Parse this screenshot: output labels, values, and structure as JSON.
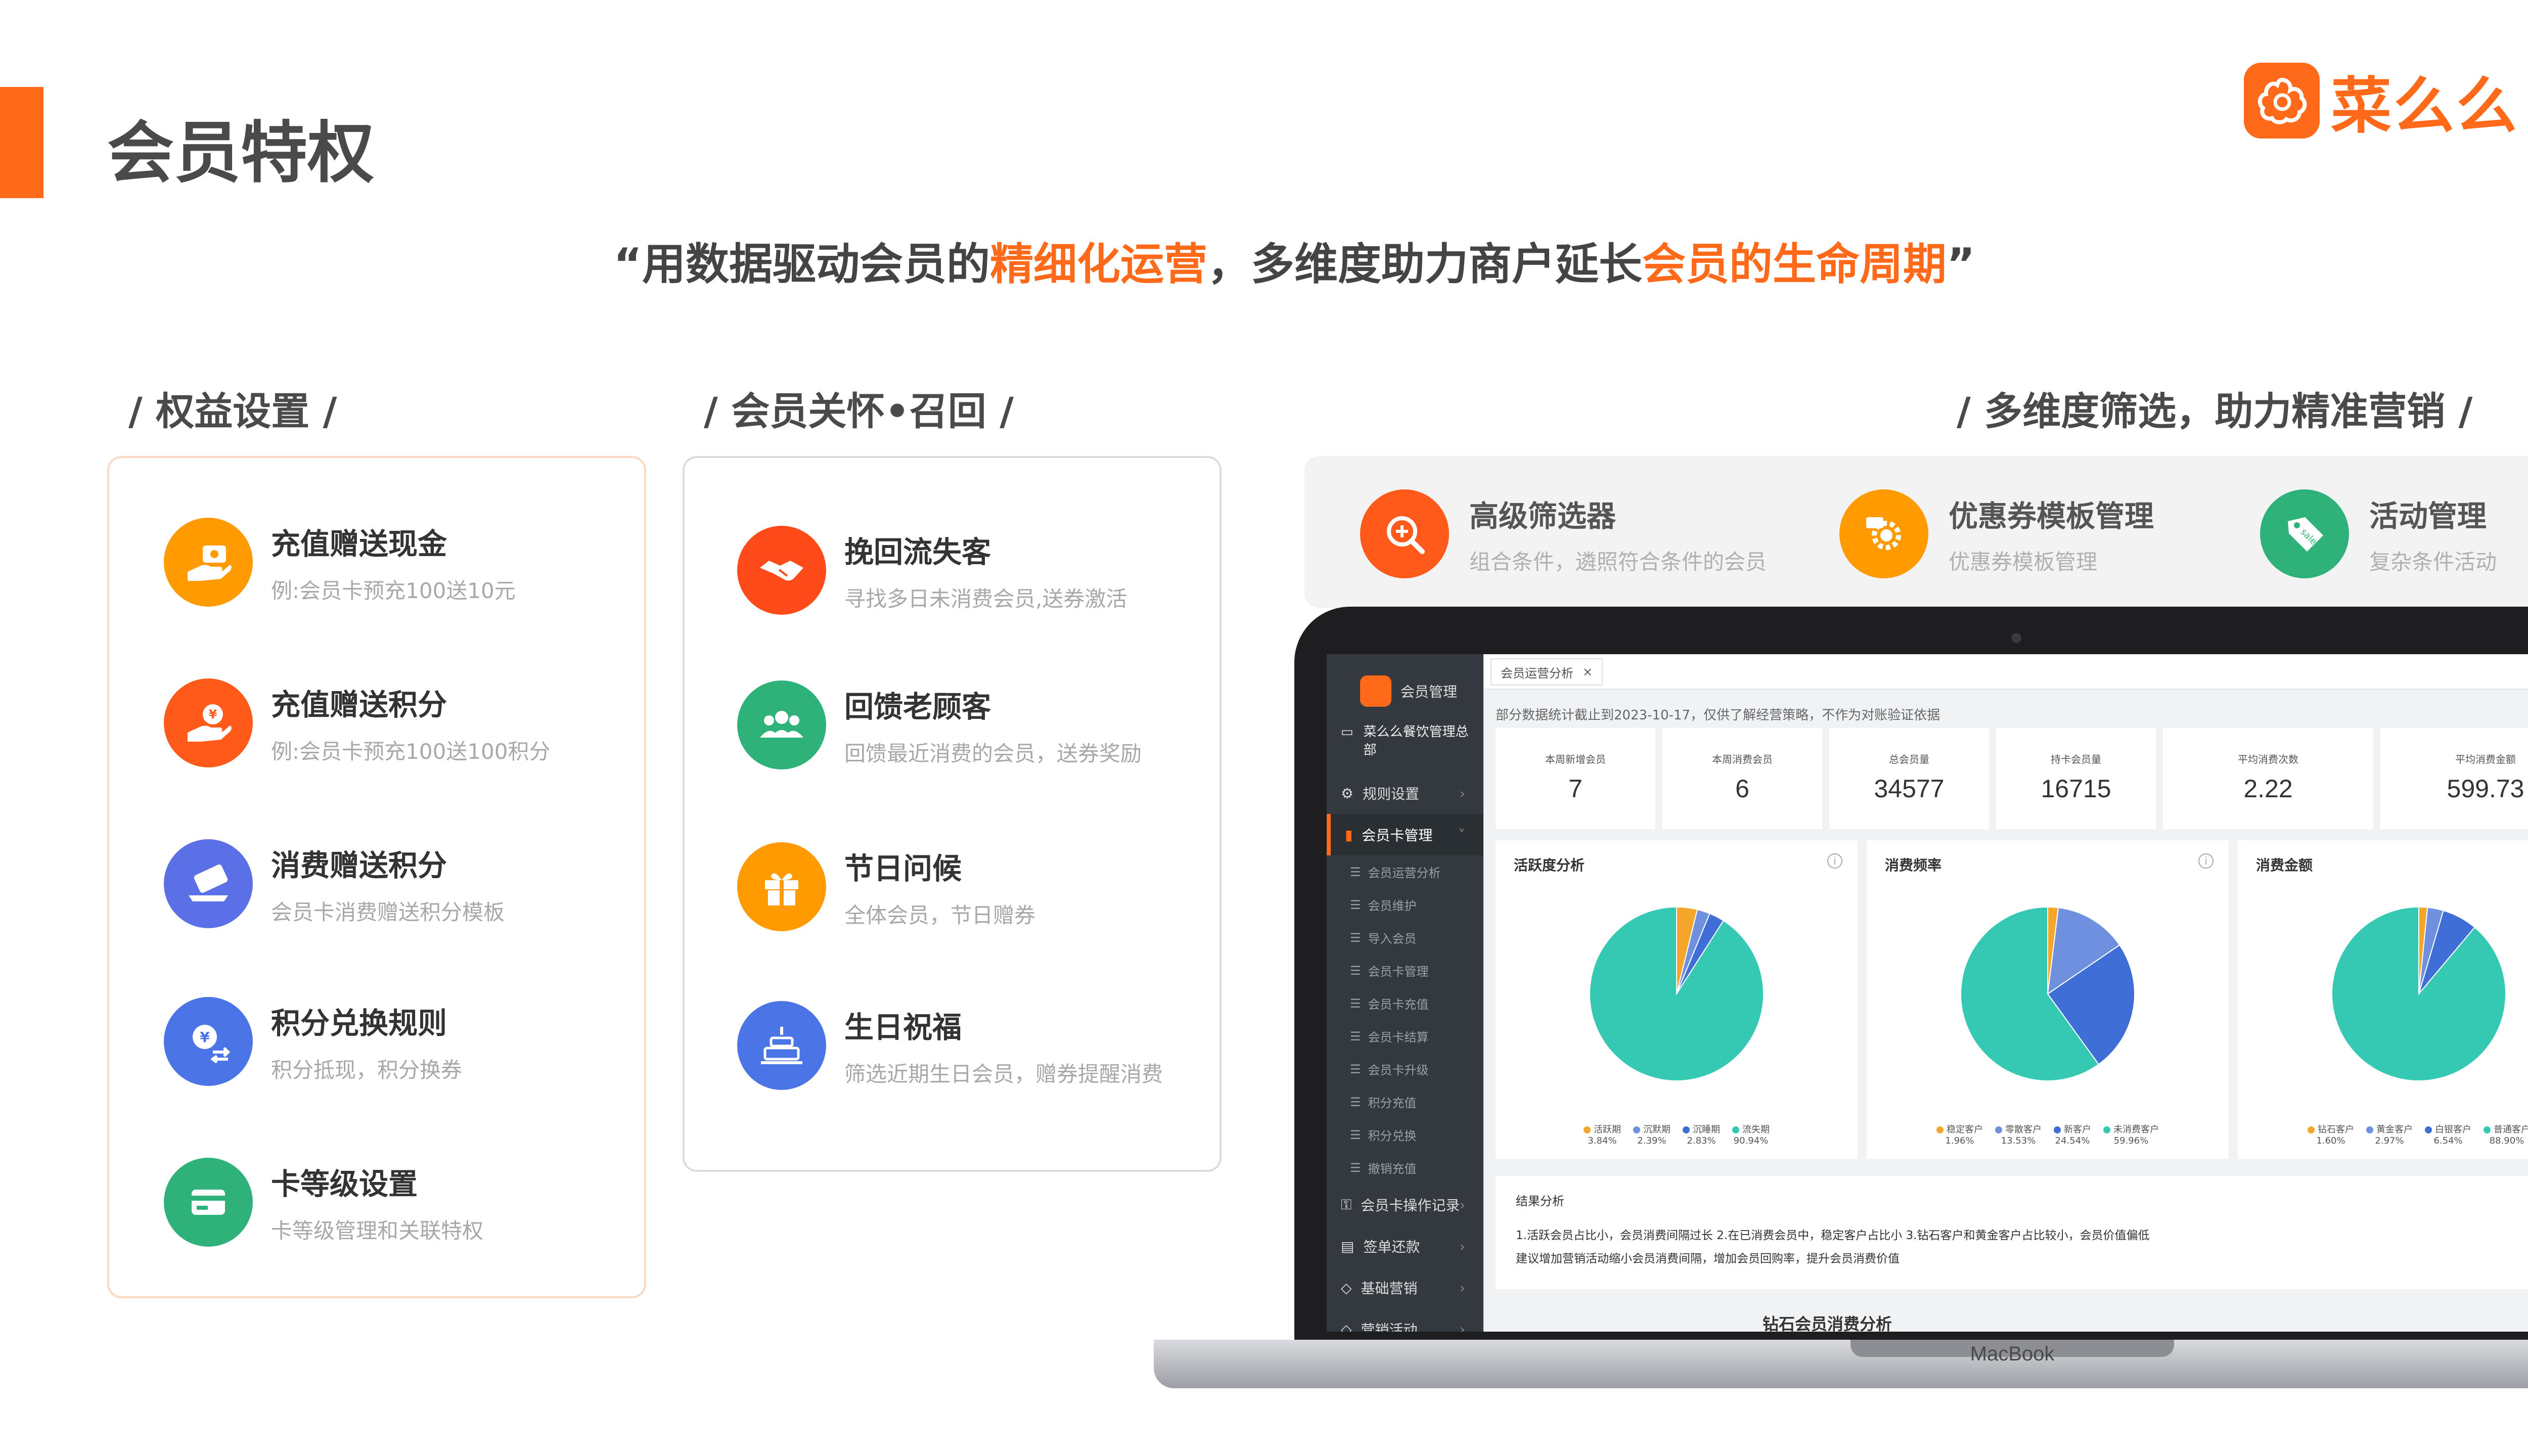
{
  "title": "会员特权",
  "brand": {
    "name": "菜么么",
    "color": "#ff6a1a"
  },
  "slogan": {
    "p1": "“用数据驱动会员的",
    "h1": "精细化运营",
    "p2": "，多维度助力商户延长",
    "h2": "会员的生命周期",
    "p3": "”"
  },
  "sections": {
    "benefits": "/ 权益设置 /",
    "care": "/ 会员关怀•召回 /",
    "filter": "/ 多维度筛选，助力精准营销 /"
  },
  "benefits": [
    {
      "title": "充值赠送现金",
      "desc": "例:会员卡预充100送10元",
      "icon": "cash-hand-icon",
      "color": "#ff9a00"
    },
    {
      "title": "充值赠送积分",
      "desc": "例:会员卡预充100送100积分",
      "icon": "points-hand-icon",
      "color": "#ff5a1a"
    },
    {
      "title": "消费赠送积分",
      "desc": "会员卡消费赠送积分模板",
      "icon": "card-swipe-icon",
      "color": "#5b6fe6"
    },
    {
      "title": "积分兑换规则",
      "desc": "积分抵现，积分换券",
      "icon": "yen-exchange-icon",
      "color": "#4b74e6"
    },
    {
      "title": "卡等级设置",
      "desc": "卡等级管理和关联特权",
      "icon": "card-icon",
      "color": "#2fb27a"
    }
  ],
  "care": [
    {
      "title": "挽回流失客",
      "desc": "寻找多日未消费会员,送券激活",
      "icon": "handshake-icon",
      "color": "#ff4a1a"
    },
    {
      "title": "回馈老顾客",
      "desc": "回馈最近消费的会员，送券奖励",
      "icon": "group-icon",
      "color": "#2fb27a"
    },
    {
      "title": "节日问候",
      "desc": "全体会员，节日赠券",
      "icon": "gift-icon",
      "color": "#ff9a00"
    },
    {
      "title": "生日祝福",
      "desc": "筛选近期生日会员，赠券提醒消费",
      "icon": "cake-icon",
      "color": "#4b74e6"
    }
  ],
  "filters": [
    {
      "title": "高级筛选器",
      "desc": "组合条件，遴照符合条件的会员",
      "icon": "zoom-icon",
      "color": "#ff5a1a"
    },
    {
      "title": "优惠券模板管理",
      "desc": "优惠券模板管理",
      "icon": "coupon-gear-icon",
      "color": "#ff9a00"
    },
    {
      "title": "活动管理",
      "desc": "复杂条件活动",
      "icon": "sale-tag-icon",
      "color": "#2fb27a"
    }
  ],
  "laptop": {
    "label": "MacBook"
  },
  "app": {
    "logo_text": "会员管理",
    "store_name": "菜么么餐饮管理总部",
    "sidebar_items": [
      {
        "label": "规则设置",
        "icon": "settings-icon"
      },
      {
        "label": "会员卡管理",
        "icon": "bar-chart-icon"
      }
    ],
    "sub_items": [
      "会员运营分析",
      "会员维护",
      "导入会员",
      "会员卡管理",
      "会员卡充值",
      "会员卡结算",
      "会员卡升级",
      "积分充值",
      "积分兑换",
      "撤销充值"
    ],
    "bottom_items": [
      {
        "label": "会员卡操作记录",
        "icon": "record-icon"
      },
      {
        "label": "签单还款",
        "icon": "doc-icon"
      },
      {
        "label": "基础营销",
        "icon": "tag-icon"
      },
      {
        "label": "营销活动",
        "icon": "tag-icon"
      }
    ],
    "tab": "会员运营分析",
    "notice": "部分数据统计截止到2023-10-17，仅供了解经营策略，不作为对账验证依据",
    "stats": [
      {
        "label": "本周新增会员",
        "value": "7"
      },
      {
        "label": "本周消费会员",
        "value": "6"
      },
      {
        "label": "总会员量",
        "value": "34577"
      },
      {
        "label": "持卡会员量",
        "value": "16715"
      },
      {
        "label": "平均消费次数",
        "value": "2.22"
      },
      {
        "label": "平均消费金额",
        "value": "599.73"
      }
    ],
    "result": {
      "title": "结果分析",
      "line1": "1.活跃会员占比小，会员消费间隔过长 2.在已消费会员中，稳定客户占比小 3.钻石客户和黄金客户占比较小，会员价值偏低",
      "line2": "建议增加营销活动缩小会员消费间隔，增加会员回购率，提升会员消费价值"
    },
    "bottom_heading": "钻石会员消费分析"
  },
  "chart_data": [
    {
      "type": "pie",
      "title": "活跃度分析",
      "categories": [
        "活跃期",
        "沉默期",
        "沉睡期",
        "流失期"
      ],
      "values": [
        3.84,
        2.39,
        2.83,
        90.94
      ],
      "labels": [
        "3.84%",
        "2.39%",
        "2.83%",
        "90.94%"
      ],
      "colors": [
        "#f4a62a",
        "#6e90de",
        "#3f6ed6",
        "#35c9b3"
      ]
    },
    {
      "type": "pie",
      "title": "消费频率",
      "categories": [
        "稳定客户",
        "零散客户",
        "新客户",
        "未消费客户"
      ],
      "values": [
        1.96,
        13.53,
        24.54,
        59.96
      ],
      "labels": [
        "1.96%",
        "13.53%",
        "24.54%",
        "59.96%"
      ],
      "colors": [
        "#f4a62a",
        "#6e90de",
        "#3f6ed6",
        "#35c9b3"
      ]
    },
    {
      "type": "pie",
      "title": "消费金额",
      "categories": [
        "钻石客户",
        "黄金客户",
        "白银客户",
        "普通客户"
      ],
      "values": [
        1.6,
        2.97,
        6.54,
        88.9
      ],
      "labels": [
        "1.60%",
        "2.97%",
        "6.54%",
        "88.90%"
      ],
      "colors": [
        "#f4a62a",
        "#6e90de",
        "#3f6ed6",
        "#35c9b3"
      ]
    }
  ]
}
